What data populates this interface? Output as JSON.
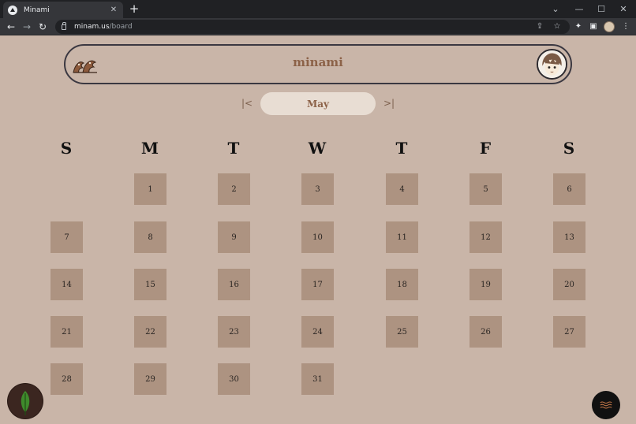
{
  "browser": {
    "tab_title": "Minami",
    "url_host": "minam.us",
    "url_path": "/board",
    "icons": [
      "back-icon",
      "forward-icon",
      "reload-icon",
      "share-icon",
      "star-icon",
      "extensions-icon",
      "sidepanel-icon",
      "menu-icon"
    ]
  },
  "header": {
    "title": "minami",
    "logo": "wave-logo",
    "avatar": "user-avatar"
  },
  "month_nav": {
    "current": "May",
    "prev_icon": "first-page-icon",
    "next_icon": "last-page-icon"
  },
  "calendar": {
    "weekdays": [
      "S",
      "M",
      "T",
      "W",
      "T",
      "F",
      "S"
    ],
    "days": [
      "1",
      "2",
      "3",
      "4",
      "5",
      "6",
      "7",
      "8",
      "9",
      "10",
      "11",
      "12",
      "13",
      "14",
      "15",
      "16",
      "17",
      "18",
      "19",
      "20",
      "21",
      "22",
      "23",
      "24",
      "25",
      "26",
      "27",
      "28",
      "29",
      "30",
      "31"
    ],
    "first_weekday_index": 1
  },
  "fabs": {
    "left": "leaf-icon",
    "right": "waves-icon"
  },
  "colors": {
    "background": "#c9b5a8",
    "day_cell": "#ad9381",
    "accent": "#8c6248",
    "pill": "#e8ddd3"
  }
}
